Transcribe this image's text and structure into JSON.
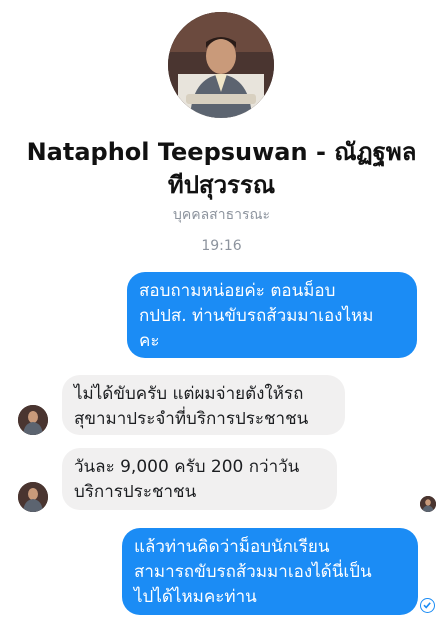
{
  "profile": {
    "name": "Nataphol Teepsuwan - ณัฏฐพล\nทีปสุวรรณ",
    "subtitle": "บุคคลสาธารณะ",
    "photo_icon": "profile-photo"
  },
  "conversation": {
    "timestamp": "19:16",
    "messages": [
      {
        "direction": "outgoing",
        "text": "สอบถามหน่อยค่ะ ตอนม็อบ\nกปปส. ท่านขับรถส้วมมาเองไหม\nคะ"
      },
      {
        "direction": "incoming",
        "text": "ไม่ได้ขับครับ แต่ผมจ่ายตังให้รถ\nสุขามาประจำที่บริการประชาชน"
      },
      {
        "direction": "incoming",
        "text": "วันละ 9,000 ครับ 200 กว่าวัน\nบริการประชาชน"
      },
      {
        "direction": "outgoing",
        "text": "แล้วท่านคิดว่าม็อบนักเรียน\nสามารถขับรถส้วมมาเองได้นี่เป็น\nไปได้ไหมคะท่าน"
      }
    ]
  },
  "colors": {
    "outgoing_bubble": "#1b8cf5",
    "incoming_bubble": "#f1f0f0",
    "muted_text": "#8d949e"
  },
  "icons": {
    "seen": "seen-avatar-icon",
    "sent": "sent-check-icon"
  }
}
